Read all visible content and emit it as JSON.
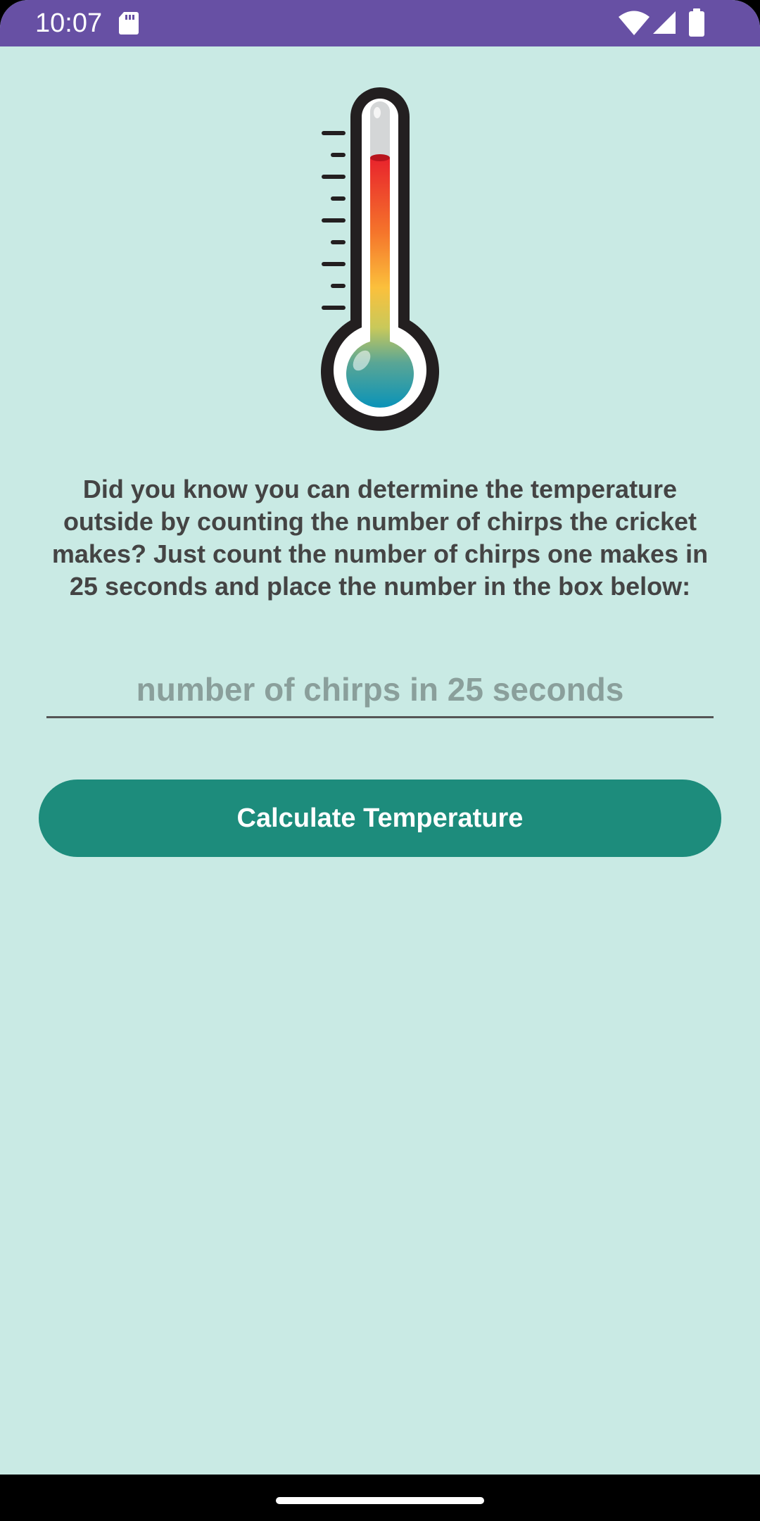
{
  "status_bar": {
    "time": "10:07",
    "icons": [
      "sd-card-icon",
      "wifi-icon",
      "signal-icon",
      "battery-icon"
    ]
  },
  "main": {
    "illustration": "thermometer-icon",
    "intro": "Did you know you can determine the temperature outside by counting the number of chirps the cricket makes? Just count the number of chirps one makes in 25 seconds and place the number in the box below:",
    "chirps_input": {
      "value": "",
      "placeholder": "number of chirps in 25 seconds"
    },
    "calculate_label": "Calculate Temperature"
  },
  "colors": {
    "status_bar": "#6750a4",
    "background": "#c9eae4",
    "button": "#1d8c7c",
    "text": "#444444"
  }
}
